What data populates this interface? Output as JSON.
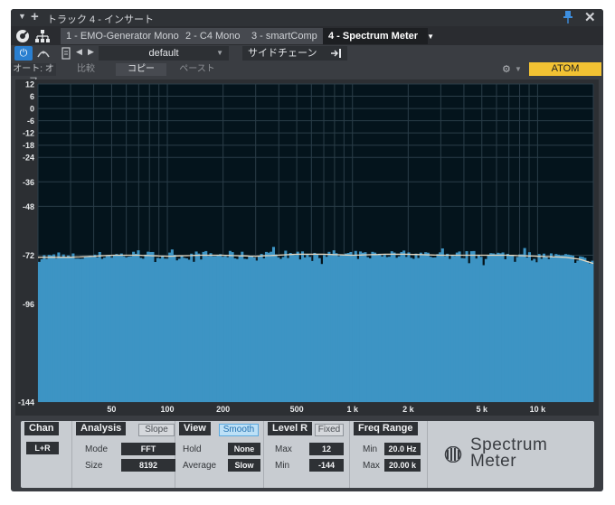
{
  "window": {
    "title": "トラック 4 - インサート"
  },
  "tabs": [
    {
      "label": "1 - EMO-Generator Mono",
      "active": false
    },
    {
      "label": "2 - C4 Mono",
      "active": false
    },
    {
      "label": "3 - smartComp",
      "active": false
    },
    {
      "label": "4 - Spectrum Meter",
      "active": true
    }
  ],
  "preset": {
    "name": "default",
    "sidechain_label": "サイドチェーン"
  },
  "options": {
    "auto_label": "オート: オフ",
    "compare_label": "比較",
    "copy_label": "コピー",
    "paste_label": "ペースト",
    "atom_label": "ATOM"
  },
  "colors": {
    "accent_blue": "#2a7fd0",
    "spectrum_fill": "#3d94c4",
    "atom_yellow": "#f2c233",
    "plot_bg": "#04141c"
  },
  "chart_data": {
    "type": "area",
    "x_scale": "log",
    "x_ticks": [
      {
        "value": 50,
        "label": "50"
      },
      {
        "value": 100,
        "label": "100"
      },
      {
        "value": 200,
        "label": "200"
      },
      {
        "value": 500,
        "label": "500"
      },
      {
        "value": 1000,
        "label": "1 k"
      },
      {
        "value": 2000,
        "label": "2 k"
      },
      {
        "value": 5000,
        "label": "5 k"
      },
      {
        "value": 10000,
        "label": "10 k"
      }
    ],
    "xlim": [
      20,
      20000
    ],
    "y_ticks": [
      {
        "value": 12,
        "label": "12"
      },
      {
        "value": 6,
        "label": "6"
      },
      {
        "value": 0,
        "label": "0"
      },
      {
        "value": -6,
        "label": "-6"
      },
      {
        "value": -12,
        "label": "-12"
      },
      {
        "value": -18,
        "label": "-18"
      },
      {
        "value": -24,
        "label": "-24"
      },
      {
        "value": -36,
        "label": "-36"
      },
      {
        "value": -48,
        "label": "-48"
      },
      {
        "value": -72,
        "label": "-72"
      },
      {
        "value": -96,
        "label": "-96"
      },
      {
        "value": -144,
        "label": "-144"
      }
    ],
    "ylim": [
      -144,
      12
    ],
    "spectrum_db": [
      [
        20,
        -73
      ],
      [
        30,
        -73
      ],
      [
        40,
        -72.5
      ],
      [
        50,
        -72
      ],
      [
        70,
        -72
      ],
      [
        100,
        -72.5
      ],
      [
        150,
        -72
      ],
      [
        200,
        -72
      ],
      [
        300,
        -72.5
      ],
      [
        500,
        -71.5
      ],
      [
        700,
        -71.5
      ],
      [
        1000,
        -72
      ],
      [
        1500,
        -71.5
      ],
      [
        2000,
        -71.5
      ],
      [
        3000,
        -72
      ],
      [
        5000,
        -72
      ],
      [
        7000,
        -72
      ],
      [
        10000,
        -72.5
      ],
      [
        14000,
        -73
      ],
      [
        17000,
        -74
      ],
      [
        20000,
        -76
      ]
    ],
    "grid": true
  },
  "controls": {
    "chan": {
      "title": "Chan",
      "value": "L+R"
    },
    "analysis": {
      "title": "Analysis",
      "slope_label": "Slope",
      "mode_label": "Mode",
      "mode_value": "FFT",
      "size_label": "Size",
      "size_value": "8192"
    },
    "view": {
      "title": "View",
      "smooth_label": "Smooth",
      "hold_label": "Hold",
      "hold_value": "None",
      "average_label": "Average",
      "average_value": "Slow"
    },
    "level": {
      "title": "Level R",
      "fixed_label": "Fixed",
      "max_label": "Max",
      "max_value": "12",
      "min_label": "Min",
      "min_value": "-144"
    },
    "freq": {
      "title": "Freq Range",
      "min_label": "Min",
      "min_value": "20.0 Hz",
      "max_label": "Max",
      "max_value": "20.00 k"
    },
    "brand": {
      "line1": "Spectrum",
      "line2": "Meter"
    }
  }
}
